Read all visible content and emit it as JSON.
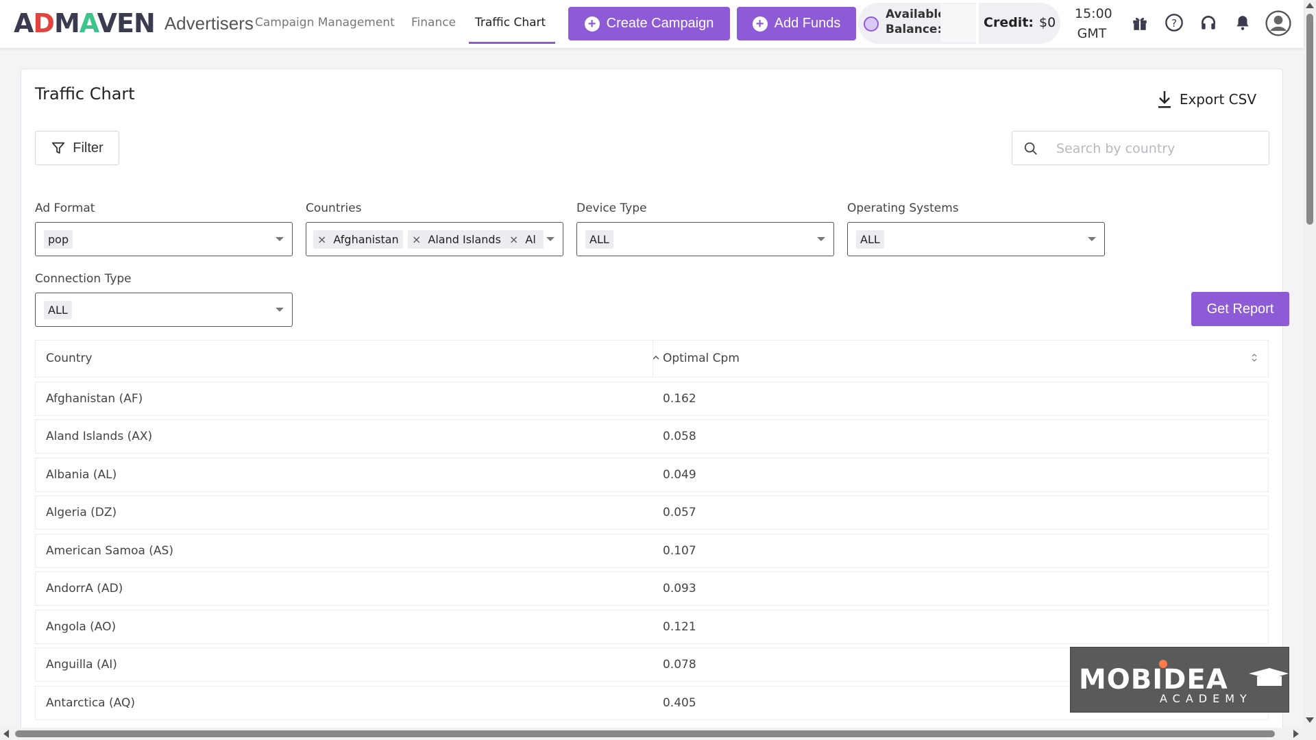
{
  "brand": {
    "logo_prefix": "A",
    "logo_d": "D",
    "logo_m": "M",
    "logo_a": "A",
    "logo_suffix": "VEN",
    "sub": "Advertisers",
    "accent": "#8e5bd6"
  },
  "nav": {
    "items": [
      "Campaign Management",
      "Finance",
      "Traffic Chart"
    ],
    "active": "Traffic Chart"
  },
  "header": {
    "create_campaign": "Create Campaign",
    "add_funds": "Add Funds",
    "available_balance": "Available Balance:",
    "credit_label": "Credit:",
    "credit_value": "$0",
    "time": "15:00 GMT",
    "icons": [
      "gift-icon",
      "help-icon",
      "headset-icon",
      "bell-icon",
      "user-avatar-icon"
    ]
  },
  "page": {
    "title": "Traffic Chart",
    "export_label": "Export CSV",
    "filter_label": "Filter",
    "search_placeholder": "Search by country",
    "get_report": "Get Report"
  },
  "filters": {
    "ad_format": {
      "label": "Ad Format",
      "value": "pop"
    },
    "countries": {
      "label": "Countries",
      "chips": [
        "Afghanistan",
        "Aland Islands",
        "Al"
      ]
    },
    "device_type": {
      "label": "Device Type",
      "value": "ALL"
    },
    "operating_systems": {
      "label": "Operating Systems",
      "value": "ALL"
    },
    "connection_type": {
      "label": "Connection Type",
      "value": "ALL"
    }
  },
  "table": {
    "columns": [
      "Country",
      "Optimal Cpm"
    ],
    "rows": [
      {
        "country": "Afghanistan (AF)",
        "cpm": "0.162"
      },
      {
        "country": "Aland Islands (AX)",
        "cpm": "0.058"
      },
      {
        "country": "Albania (AL)",
        "cpm": "0.049"
      },
      {
        "country": "Algeria (DZ)",
        "cpm": "0.057"
      },
      {
        "country": "American Samoa (AS)",
        "cpm": "0.107"
      },
      {
        "country": "AndorrA (AD)",
        "cpm": "0.093"
      },
      {
        "country": "Angola (AO)",
        "cpm": "0.121"
      },
      {
        "country": "Anguilla (AI)",
        "cpm": "0.078"
      },
      {
        "country": "Antarctica (AQ)",
        "cpm": "0.405"
      }
    ]
  },
  "watermark": {
    "brand": "MOBIDEA",
    "sub": "ACADEMY"
  }
}
